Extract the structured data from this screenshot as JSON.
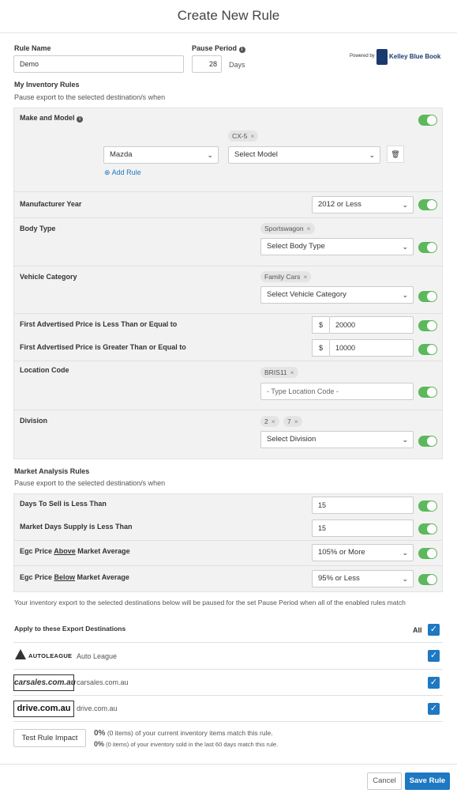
{
  "header": {
    "title": "Create New Rule"
  },
  "form": {
    "rule_name_label": "Rule Name",
    "rule_name_value": "Demo",
    "pause_period_label": "Pause Period",
    "pause_value": "28",
    "pause_unit": "Days",
    "powered_by": "Powered by",
    "kbb": "Kelley Blue Book"
  },
  "inventory": {
    "title": "My Inventory Rules",
    "subtitle": "Pause export to the selected destination/s when",
    "make_model_label": "Make and Model",
    "model_tag": "CX-5",
    "make_value": "Mazda",
    "model_placeholder": "Select Model",
    "add_rule": "Add Rule",
    "year_label": "Manufacturer Year",
    "year_value": "2012 or Less",
    "body_label": "Body Type",
    "body_tag": "Sportswagon",
    "body_placeholder": "Select Body Type",
    "category_label": "Vehicle Category",
    "category_tag": "Family Cars",
    "category_placeholder": "Select Vehicle Category",
    "price_lte_label": "First Advertised Price is Less Than or Equal to",
    "price_lte_value": "20000",
    "price_gte_label": "First Advertised Price is Greater Than or Equal to",
    "price_gte_value": "10000",
    "currency": "$",
    "location_label": "Location Code",
    "location_tag": "BRIS11",
    "location_placeholder": "- Type Location Code -",
    "division_label": "Division",
    "division_tags": [
      "2",
      "7"
    ],
    "division_placeholder": "Select Division"
  },
  "market": {
    "title": "Market Analysis Rules",
    "subtitle": "Pause export to the selected destination/s when",
    "days_sell_label": "Days To Sell is Less Than",
    "days_sell_value": "15",
    "mds_label": "Market Days Supply is Less Than",
    "mds_value": "15",
    "above_pre": "Egc Price ",
    "above_u": "Above",
    "above_post": " Market Average",
    "above_value": "105% or More",
    "below_pre": "Egc Price ",
    "below_u": "Below",
    "below_post": " Market Average",
    "below_value": "95% or Less"
  },
  "note": "Your inventory export to the selected destinations below will be paused for the set Pause Period when all of the enabled rules match",
  "destinations": {
    "title": "Apply to these Export Destinations",
    "all_label": "All",
    "items": [
      {
        "logo": "AUTOLEAGUE",
        "name": "Auto League"
      },
      {
        "logo": "carsales.com.au",
        "name": "carsales.com.au"
      },
      {
        "logo": "drive.com.au",
        "name": "drive.com.au"
      }
    ]
  },
  "impact": {
    "button": "Test Rule Impact",
    "line1_pct": "0%",
    "line1_text": " (0 items) of your current inventory items match this rule.",
    "line2_pct": "0%",
    "line2_text": " (0 items) of your inventory sold in the last 60 days match this rule."
  },
  "footer": {
    "cancel": "Cancel",
    "save": "Save Rule"
  },
  "colors": {
    "accent": "#1e78c2",
    "toggle_on": "#5cb85c"
  }
}
